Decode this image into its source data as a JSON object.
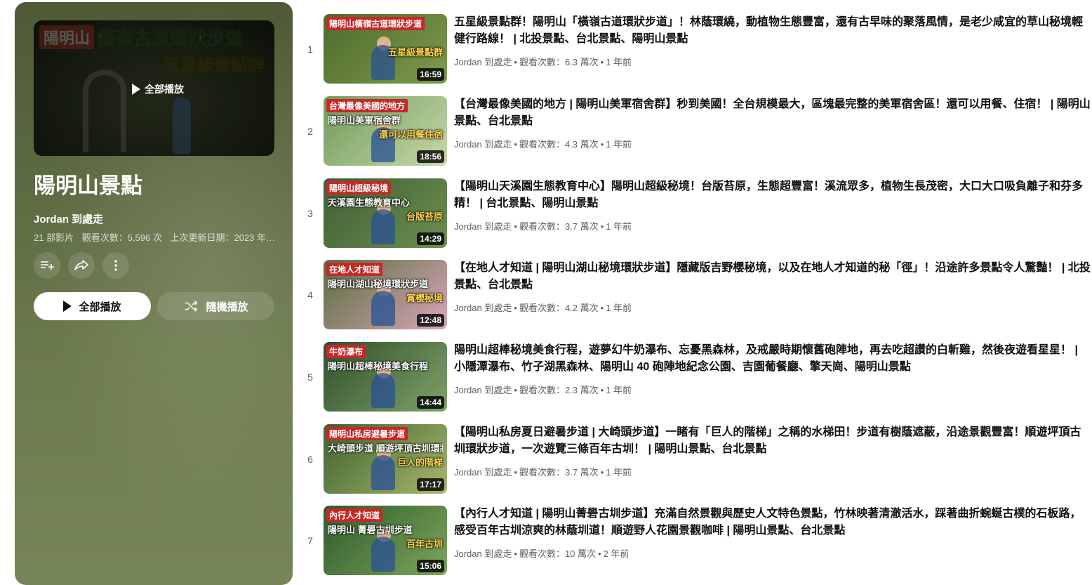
{
  "playlist": {
    "hero_title_red": "陽明山",
    "hero_title_main": "橫嶺古道環狀步道",
    "hero_title_sub": "五星級景點群",
    "hero_play_label": "全部播放",
    "title": "陽明山景點",
    "channel": "Jordan 到處走",
    "meta_videos": "21 部影片",
    "meta_views": "觀看次數：5,596 次",
    "meta_updated": "上次更新日期：2023 年 ...",
    "play_all_label": "全部播放",
    "shuffle_label": "隨機播放"
  },
  "icons": {
    "save": "playlist-add-icon",
    "share": "share-icon",
    "more": "more-vert-icon",
    "play": "play-icon",
    "shuffle": "shuffle-icon"
  },
  "videos": [
    {
      "index": "1",
      "title": "五星級景點群！陽明山「橫嶺古道環狀步道」！林蔭環繞，動植物生態豐富，還有古早味的聚落風情，是老少咸宜的草山秘境輕健行路線！ | 北投景點、台北景點、陽明山景點",
      "channel": "Jordan 到處走",
      "views": "觀看次數：6.3 萬次",
      "age": "1 年前",
      "duration": "16:59",
      "thumb_tag": "陽明山橫嶺古道環狀步道",
      "thumb_caption": "",
      "thumb_sub": "五星級景點群",
      "thumb_colors": [
        "#4f6b2e",
        "#7d9a4a"
      ]
    },
    {
      "index": "2",
      "title": "【台灣最像美國的地方 | 陽明山美軍宿舍群】秒到美國！全台規模最大，區塊最完整的美軍宿舍區！還可以用餐、住宿！ | 陽明山景點、台北景點",
      "channel": "Jordan 到處走",
      "views": "觀看次數：4.3 萬次",
      "age": "1 年前",
      "duration": "18:56",
      "thumb_tag": "台灣最像美國的地方",
      "thumb_caption": "陽明山美軍宿舍群",
      "thumb_sub": "還可以用餐住宿",
      "thumb_colors": [
        "#6f9a5a",
        "#c8d9a8"
      ]
    },
    {
      "index": "3",
      "title": "【陽明山天溪園生態教育中心】陽明山超級秘境！台版苔原，生態超豐富！溪流眾多，植物生長茂密，大口大口吸負離子和芬多精！ | 台北景點、陽明山景點",
      "channel": "Jordan 到處走",
      "views": "觀看次數：3.7 萬次",
      "age": "1 年前",
      "duration": "14:29",
      "thumb_tag": "陽明山超級秘境",
      "thumb_caption": "天溪園生態教育中心",
      "thumb_sub": "台版苔原",
      "thumb_colors": [
        "#3e5f35",
        "#6e8f4f"
      ]
    },
    {
      "index": "4",
      "title": "【在地人才知道 | 陽明山湖山秘境環狀步道】隱藏版吉野櫻秘境，以及在地人才知道的秘「徑」！沿途許多景點令人驚豔！ | 北投景點、台北景點",
      "channel": "Jordan 到處走",
      "views": "觀看次數：4.2 萬次",
      "age": "1 年前",
      "duration": "12:48",
      "thumb_tag": "在地人才知道",
      "thumb_caption": "陽明山湖山秘境環狀步道",
      "thumb_sub": "賞櫻秘境",
      "thumb_colors": [
        "#5a6e3f",
        "#d8a6b8"
      ]
    },
    {
      "index": "5",
      "title": "陽明山超棒秘境美食行程，遊夢幻牛奶瀑布、忘憂黑森林，及戒嚴時期懷舊砲陣地，再去吃超讚的白斬雞，然後夜遊看星星！ | 小隱潭瀑布、竹子湖黑森林、陽明山 40 砲陣地紀念公園、吉園葡餐廳、擎天崗、陽明山景點",
      "channel": "Jordan 到處走",
      "views": "觀看次數：2.3 萬次",
      "age": "1 年前",
      "duration": "14:44",
      "thumb_tag": "牛奶瀑布",
      "thumb_caption": "陽明山超棒秘境美食行程",
      "thumb_sub": "",
      "thumb_colors": [
        "#2f4f2a",
        "#7fa36a"
      ]
    },
    {
      "index": "6",
      "title": "【陽明山私房夏日避暑步道 | 大崎頭步道】一睹有「巨人的階梯」之稱的水梯田！步道有樹蔭遮蔽，沿途景觀豐富！順遊坪頂古圳環狀步道，一次遊覽三條百年古圳！ | 陽明山景點、台北景點",
      "channel": "Jordan 到處走",
      "views": "觀看次數：3.7 萬次",
      "age": "1 年前",
      "duration": "17:17",
      "thumb_tag": "陽明山私房避暑步道",
      "thumb_caption": "大崎頭步道 順遊坪頂古圳環狀步道",
      "thumb_sub": "巨人的階梯",
      "thumb_colors": [
        "#3b6130",
        "#a9b86a"
      ]
    },
    {
      "index": "7",
      "title": "【內行人才知道 | 陽明山菁礐古圳步道】充滿自然景觀與歷史人文特色景點，竹林映著清澈活水，踩著曲折蜿蜒古樸的石板路，感受百年古圳涼爽的林蔭圳道！順遊野人花園景觀咖啡 | 陽明山景點、台北景點",
      "channel": "Jordan 到處走",
      "views": "觀看次數：10 萬次",
      "age": "2 年前",
      "duration": "15:06",
      "thumb_tag": "內行人才知道",
      "thumb_caption": "陽明山 菁礐古圳步道",
      "thumb_sub": "百年古圳",
      "thumb_colors": [
        "#2e5a2c",
        "#7ea65a"
      ]
    }
  ]
}
